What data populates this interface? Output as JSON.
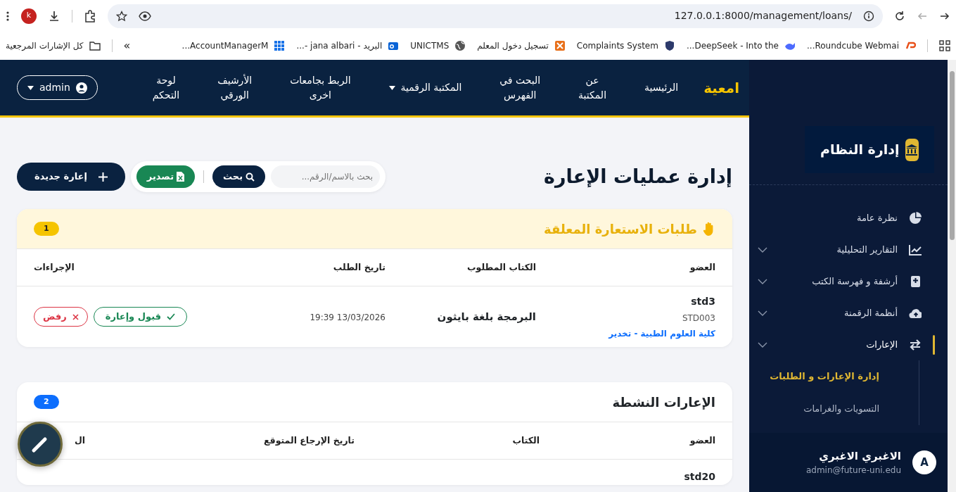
{
  "browser": {
    "profile_initial": "k",
    "url": "127.0.0.1:8000/management/loans/",
    "all_bookmarks": "كل الإشارات المرجعية",
    "overflow": "»",
    "bookmarks": [
      {
        "label": "Roundcube Webmai...",
        "kind": "cpanel"
      },
      {
        "label": "DeepSeek - Into the...",
        "kind": "whale"
      },
      {
        "label": "Complaints System",
        "kind": "shield"
      },
      {
        "label": "تسجيل دخول المعلم",
        "kind": "app"
      },
      {
        "label": "UNICTMS",
        "kind": "globe"
      },
      {
        "label": "البريد - jana albari -...",
        "kind": "mail"
      },
      {
        "label": "AccountManagerM...",
        "kind": "grid"
      }
    ]
  },
  "navbar": {
    "brand": "امعية",
    "user": "admin",
    "links": [
      {
        "label": "الرئيسية",
        "dropdown": false
      },
      {
        "label": "عن\nالمكتبة",
        "dropdown": false
      },
      {
        "label": "البحث في\nالفهرس",
        "dropdown": false
      },
      {
        "label": "المكتبة الرقمية",
        "dropdown": true
      },
      {
        "label": "الربط بجامعات\nاخرى",
        "dropdown": false
      },
      {
        "label": "الأرشيف\nالورقي",
        "dropdown": false
      },
      {
        "label": "لوحة\nالتحكم",
        "dropdown": false
      }
    ]
  },
  "page": {
    "title": "إدارة عمليات الإعارة",
    "search": {
      "placeholder": "بحث بالاسم/الرقم..."
    },
    "search_button": "بحث",
    "export_button": "تصدير",
    "new_button": "إعارة جديدة"
  },
  "pending": {
    "title": "طلبات الاستعارة المعلقة",
    "count": "1",
    "columns": [
      "العضو",
      "الكتاب المطلوب",
      "تاريخ الطلب",
      "الإجراءات"
    ],
    "rows": [
      {
        "member": "std3",
        "member_id": "STD003",
        "faculty": "كلية العلوم الطبية - تخدير",
        "book": "البرمجة بلغة بايثون",
        "date": "13/03/2026 19:39",
        "accept": "قبول وإعارة",
        "reject": "رفض"
      }
    ]
  },
  "active": {
    "title": "الإعارات النشطة",
    "count": "2",
    "columns": [
      "العضو",
      "الكتاب",
      "تاريخ الإرجاع المتوقع",
      "ال"
    ],
    "rows": [
      {
        "member": "std20"
      }
    ]
  },
  "sidebar": {
    "title": "إدارة النظام",
    "items": [
      {
        "label": "نظرة عامة",
        "kind": "pie",
        "expandable": false,
        "selected": false
      },
      {
        "label": "التقارير التحليلية",
        "kind": "chart",
        "expandable": true,
        "selected": false
      },
      {
        "label": "أرشفة و فهرسة الكتب",
        "kind": "book",
        "expandable": true,
        "selected": false
      },
      {
        "label": "أنظمة الرقمنة",
        "kind": "cloud",
        "expandable": true,
        "selected": false
      },
      {
        "label": "الإعارات",
        "kind": "swap",
        "expandable": true,
        "selected": true,
        "children": [
          {
            "label": "إدارة الإعارات و الطلبات",
            "selected": true
          },
          {
            "label": "التسويات والغرامات",
            "selected": false
          }
        ]
      }
    ],
    "user": {
      "name": "الاغبري الاغبري",
      "email": "admin@future-uni.edu",
      "initial": "A"
    }
  }
}
